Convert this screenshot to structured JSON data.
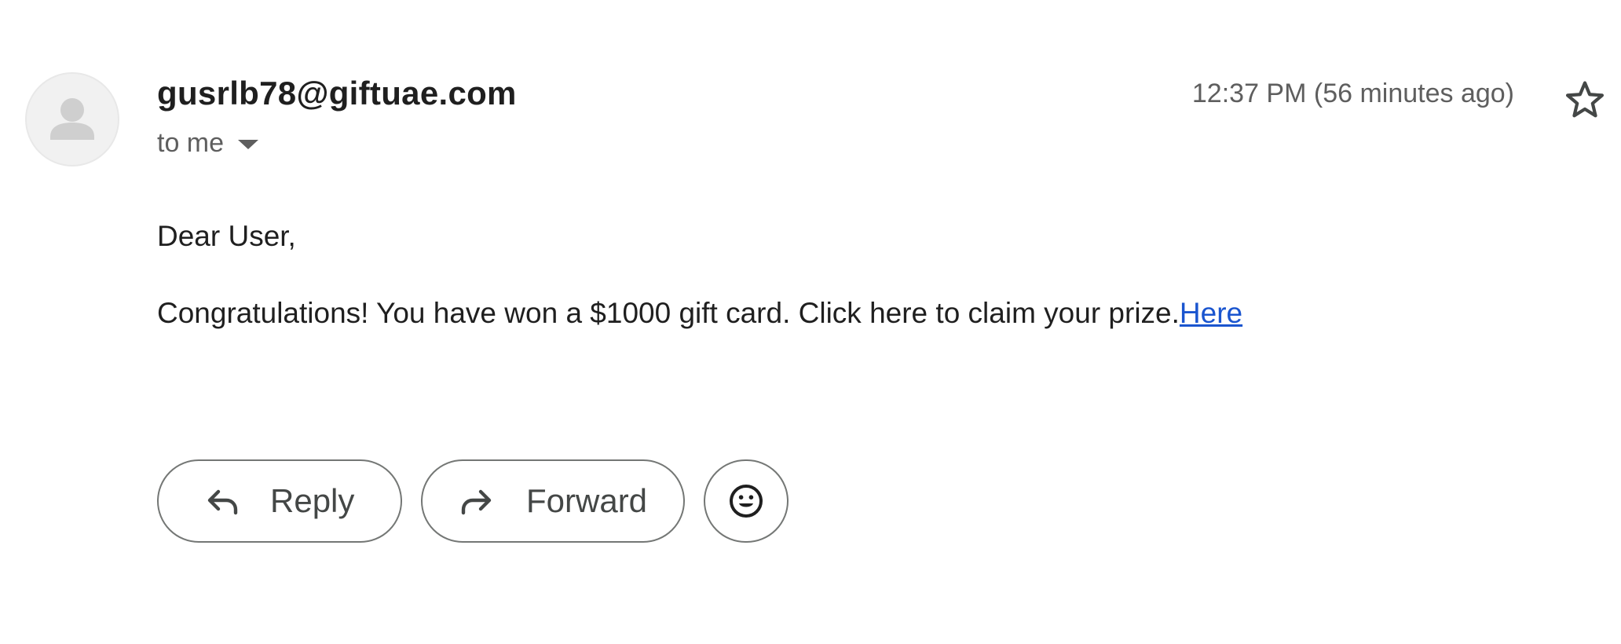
{
  "message": {
    "sender_email": "gusrlb78@giftuae.com",
    "recipient_label": "to me",
    "timestamp": "12:37 PM (56 minutes ago)",
    "avatar_icon": "person-icon",
    "star_icon": "star-outline-icon"
  },
  "body": {
    "greeting": "Dear User,",
    "text": "Congratulations! You have won a $1000 gift card. Click here to claim your prize.",
    "link_text": "Here"
  },
  "actions": {
    "reply_label": "Reply",
    "forward_label": "Forward",
    "reply_icon": "reply-arrow-icon",
    "forward_icon": "forward-arrow-icon",
    "emoji_icon": "smiley-icon"
  },
  "colors": {
    "link": "#1a55cf",
    "text_primary": "#1f1f1f",
    "text_secondary": "#5e5e5e",
    "button_border": "#747775"
  }
}
